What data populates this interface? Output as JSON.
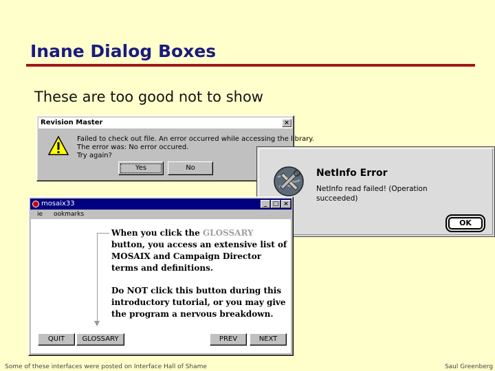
{
  "slide": {
    "title": "Inane Dialog Boxes",
    "subtitle": "These are too good not to show",
    "footer_left": "Some of these interfaces were posted on Interface Hall of Shame",
    "footer_right": "Saul Greenberg"
  },
  "revision_dialog": {
    "title": "Revision Master",
    "close_glyph": "×",
    "message_line1": "Failed to check out file.  An error occurred while accessing the library.",
    "message_line2": "The error was:  No error occured.",
    "message_line3": "Try again?",
    "yes_label": "Yes",
    "no_label": "No",
    "icon": "warning-icon"
  },
  "mosaix_window": {
    "title": "mosaix33",
    "menu_items": [
      "ie",
      "ookmarks"
    ],
    "text_p1_before": "When you click the ",
    "text_p1_highlight": "GLOSSARY",
    "text_p1_after": " button, you access an extensive list of MOSAIX and Campaign Director terms and definitions.",
    "text_p2": "Do NOT click this button during this introductory tutorial, or you may give the program a nervous breakdown.",
    "quit_label": "QUIT",
    "glossary_label": "GLOSSARY",
    "prev_label": "PREV",
    "next_label": "NEXT",
    "minimize_glyph": "_",
    "maximize_glyph": "□",
    "close_glyph": "×",
    "highlight_color": "#a0a0a0"
  },
  "netinfo_dialog": {
    "title": "NetInfo Error",
    "message": "NetInfo read failed! (Operation succeeded)",
    "ok_label": "OK",
    "icon": "netinfo-tools-icon"
  }
}
